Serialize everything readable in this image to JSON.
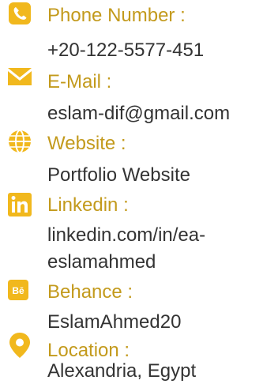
{
  "accent_color": "#f1b81d",
  "label_color": "#c39a1c",
  "text_color": "#333333",
  "contacts": [
    {
      "icon": "phone-icon",
      "label": "Phone Number :",
      "value": "+20-122-5577-451"
    },
    {
      "icon": "email-icon",
      "label": "E-Mail :",
      "value": "eslam-dif@gmail.com"
    },
    {
      "icon": "globe-icon",
      "label": "Website :",
      "value": "Portfolio Website"
    },
    {
      "icon": "linkedin-icon",
      "label": "Linkedin :",
      "value_line1": "linkedin.com/in/ea-",
      "value_line2": "eslamahmed"
    },
    {
      "icon": "behance-icon",
      "label": "Behance :",
      "value": "EslamAhmed20"
    },
    {
      "icon": "location-pin-icon",
      "label": "Location :",
      "value": "Alexandria, Egypt"
    }
  ]
}
